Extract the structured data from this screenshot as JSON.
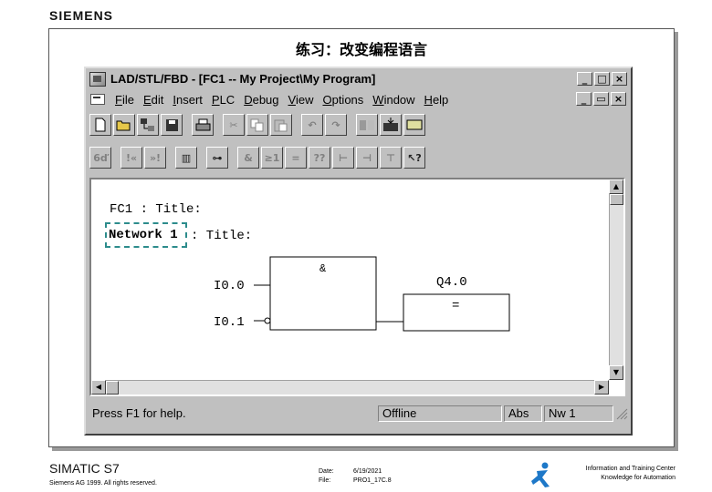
{
  "header": {
    "brand": "SIEMENS"
  },
  "slide": {
    "title": "练习：改变编程语言"
  },
  "window": {
    "title": "LAD/STL/FBD  - [FC1 -- My Project\\My Program]",
    "controls": {
      "minimize": "_",
      "maximize": "□",
      "close": "×",
      "doc_restore": "▭"
    },
    "menu": [
      {
        "label": "File",
        "accel": "F"
      },
      {
        "label": "Edit",
        "accel": "E"
      },
      {
        "label": "Insert",
        "accel": "I"
      },
      {
        "label": "PLC",
        "accel": "P"
      },
      {
        "label": "Debug",
        "accel": "D"
      },
      {
        "label": "View",
        "accel": "V"
      },
      {
        "label": "Options",
        "accel": "O"
      },
      {
        "label": "Window",
        "accel": "W"
      },
      {
        "label": "Help",
        "accel": "H"
      }
    ],
    "toolbar1": [
      "new-icon",
      "open-icon",
      "accessible-nodes-icon",
      "save-icon",
      "print-icon",
      "cut-icon",
      "copy-icon",
      "paste-icon",
      "undo-icon",
      "redo-icon",
      "monitor-icon",
      "download-icon",
      "display-icon"
    ],
    "toolbar2": [
      "overview-icon",
      "prev-network-icon",
      "next-network-icon",
      "details-icon",
      "network-icon",
      "and-box-icon",
      "or-box-icon",
      "assign-icon",
      "empty-box-icon",
      "branch-open-icon",
      "branch-close-icon",
      "connection-icon",
      "help-cursor-icon"
    ],
    "toolbar2_glyphs": [
      "6ď",
      "!«",
      "»!",
      "▥",
      "⊶",
      "&",
      "≥1",
      "=",
      "??",
      "⊢",
      "⊣",
      "⊤",
      "↖?"
    ],
    "editor": {
      "block_title": "FC1 : Title:",
      "network_label": "Network 1",
      "network_title": ": Title:",
      "gate_label": "&",
      "input1": "I0.0",
      "input2": "I0.1",
      "output_label": "Q4.0",
      "output_op": "="
    },
    "status": {
      "help": "Press F1 for help.",
      "mode": "Offline",
      "address": "Abs",
      "network": "Nw 1"
    }
  },
  "footer": {
    "product": "SIMATIC S7",
    "copyright": "Siemens AG 1999. All rights reserved.",
    "date_label": "Date:",
    "date_value": "6/19/2021",
    "file_label": "File:",
    "file_value": "PRO1_17C.8",
    "center_line1": "Information and Training Center",
    "center_line2": "Knowledge for Automation"
  },
  "colors": {
    "window_bg": "#c0c0c0",
    "network_dash": "#2d8c8c",
    "logo": "#1e78c8"
  }
}
